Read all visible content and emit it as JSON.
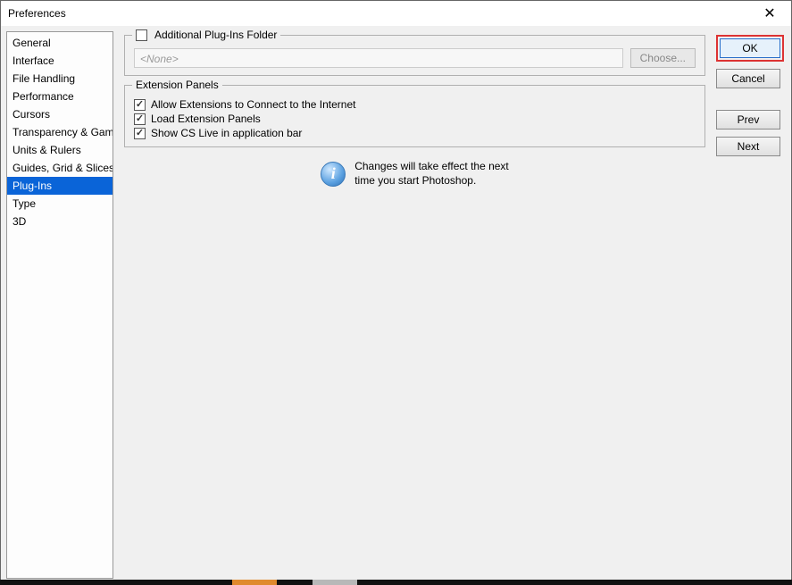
{
  "window": {
    "title": "Preferences"
  },
  "sidebar": {
    "items": [
      {
        "label": "General"
      },
      {
        "label": "Interface"
      },
      {
        "label": "File Handling"
      },
      {
        "label": "Performance"
      },
      {
        "label": "Cursors"
      },
      {
        "label": "Transparency & Gamut"
      },
      {
        "label": "Units & Rulers"
      },
      {
        "label": "Guides, Grid & Slices"
      },
      {
        "label": "Plug-Ins"
      },
      {
        "label": "Type"
      },
      {
        "label": "3D"
      }
    ],
    "selected_index": 8
  },
  "plugins_group": {
    "legend": "Additional Plug-Ins Folder",
    "folder_enabled": false,
    "path_placeholder": "<None>",
    "choose_label": "Choose..."
  },
  "extensions_group": {
    "legend": "Extension Panels",
    "options": [
      {
        "label": "Allow Extensions to Connect to the Internet",
        "checked": true
      },
      {
        "label": "Load Extension Panels",
        "checked": true
      },
      {
        "label": "Show CS Live in application bar",
        "checked": true
      }
    ]
  },
  "info_message": {
    "line1": "Changes will take effect the next",
    "line2": "time you start Photoshop."
  },
  "buttons": {
    "ok": "OK",
    "cancel": "Cancel",
    "prev": "Prev",
    "next": "Next"
  }
}
